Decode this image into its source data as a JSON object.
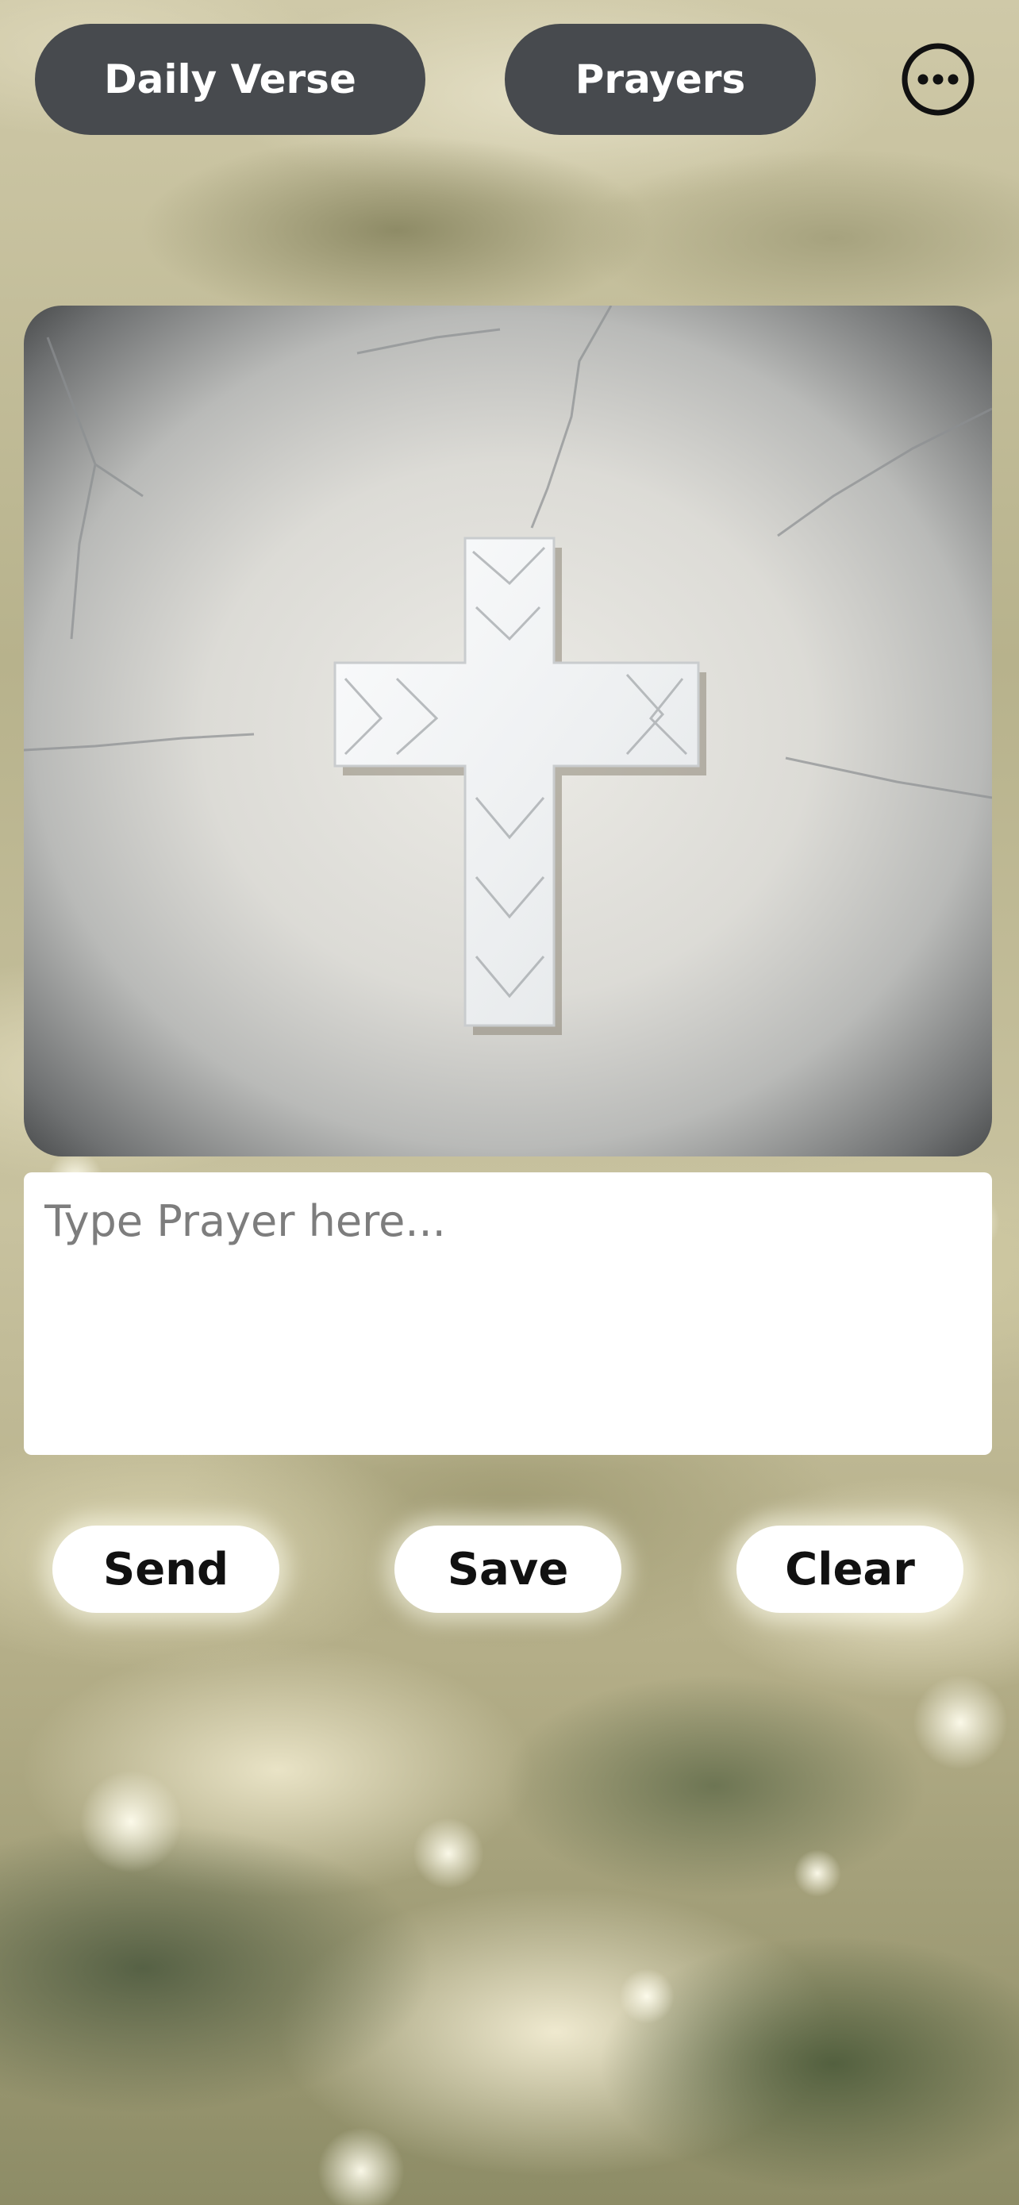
{
  "header": {
    "daily_verse_label": "Daily Verse",
    "prayers_label": "Prayers",
    "more_icon": "more-horizontal-circle-icon"
  },
  "main": {
    "image_subject": "white-cross-on-wall",
    "prayer_input": {
      "placeholder": "Type Prayer here...",
      "value": ""
    },
    "actions": {
      "send_label": "Send",
      "save_label": "Save",
      "clear_label": "Clear"
    }
  },
  "colors": {
    "top_button_bg": "#474a4e",
    "top_button_text": "#ffffff",
    "action_button_bg": "#ffffff",
    "action_button_text": "#111111",
    "input_bg": "#ffffff",
    "placeholder_text": "#7d7d7d"
  }
}
